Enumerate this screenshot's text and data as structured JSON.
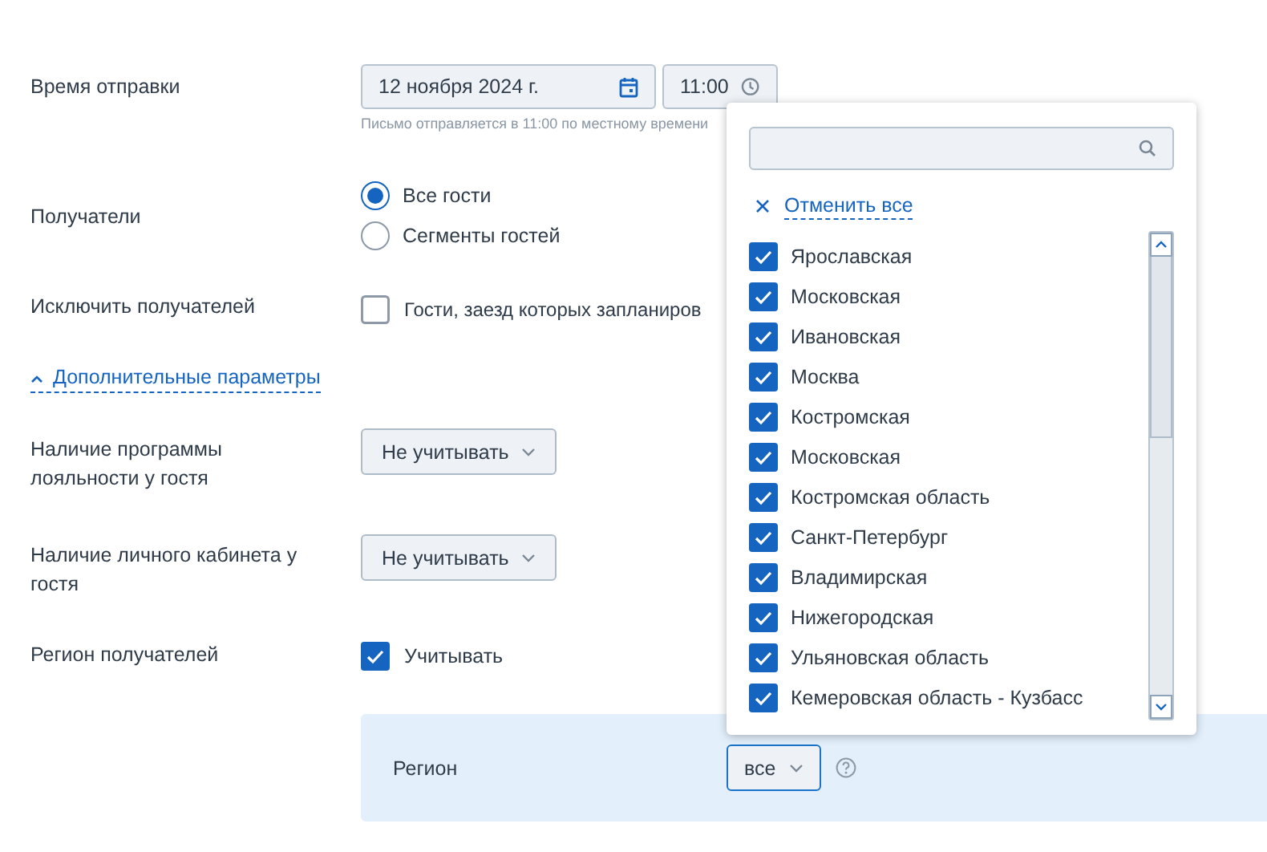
{
  "send_time": {
    "label": "Время отправки",
    "date": "12 ноября 2024 г.",
    "time": "11:00",
    "hint": "Письмо отправляется в 11:00 по местному времени"
  },
  "recipients": {
    "label": "Получатели",
    "options": [
      {
        "label": "Все гости",
        "selected": true
      },
      {
        "label": "Сегменты гостей",
        "selected": false
      }
    ]
  },
  "exclude": {
    "label": "Исключить получателей",
    "option": {
      "label": "Гости, заезд которых запланиров",
      "checked": false
    }
  },
  "advanced_toggle": {
    "label": "Дополнительные параметры",
    "expanded": true
  },
  "selects": [
    {
      "label": "Наличие программы лояльности у гостя",
      "value": "Не учитывать"
    },
    {
      "label": "Наличие личного кабинета у гостя",
      "value": "Не учитывать"
    }
  ],
  "region_filter": {
    "label": "Регион получателей",
    "option": {
      "label": "Учитывать",
      "checked": true
    }
  },
  "region_panel": {
    "label": "Регион",
    "value": "все"
  },
  "region_popup": {
    "clear_all": "Отменить все",
    "items": [
      {
        "label": "Ярославская",
        "checked": true
      },
      {
        "label": "Московская",
        "checked": true
      },
      {
        "label": "Ивановская",
        "checked": true
      },
      {
        "label": "Москва",
        "checked": true
      },
      {
        "label": "Костромская",
        "checked": true
      },
      {
        "label": "Московская",
        "checked": true
      },
      {
        "label": "Костромская область",
        "checked": true
      },
      {
        "label": "Санкт-Петербург",
        "checked": true
      },
      {
        "label": "Владимирская",
        "checked": true
      },
      {
        "label": "Нижегородская",
        "checked": true
      },
      {
        "label": "Ульяновская область",
        "checked": true
      },
      {
        "label": "Кемеровская область - Кузбасс",
        "checked": true
      }
    ]
  }
}
